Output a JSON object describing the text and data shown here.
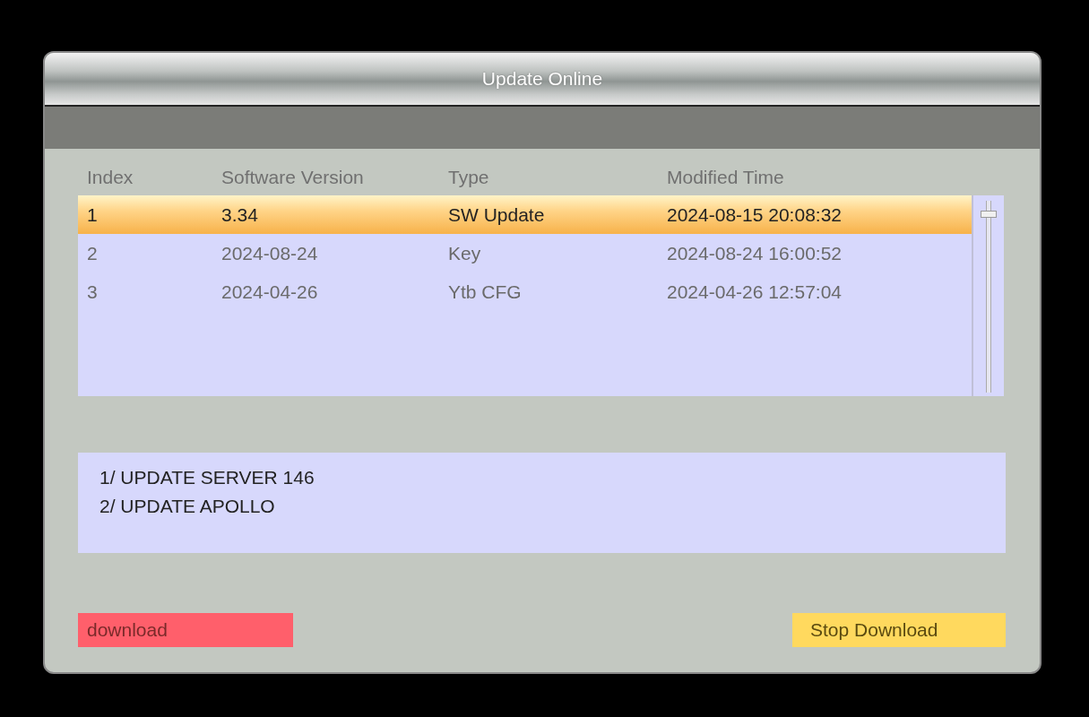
{
  "window": {
    "title": "Update Online"
  },
  "table": {
    "columns": [
      "Index",
      "Software Version",
      "Type",
      "Modified Time"
    ],
    "rows": [
      {
        "cells": [
          "1",
          "3.34",
          "SW Update",
          "2024-08-15 20:08:32"
        ],
        "selected": true
      },
      {
        "cells": [
          "2",
          "2024-08-24",
          "Key",
          "2024-08-24 16:00:52"
        ],
        "selected": false
      },
      {
        "cells": [
          "3",
          "2024-04-26",
          "Ytb CFG",
          "2024-04-26 12:57:04"
        ],
        "selected": false
      }
    ]
  },
  "notes": [
    "1/ UPDATE SERVER 146",
    "2/ UPDATE APOLLO"
  ],
  "buttons": [
    {
      "label": "download",
      "color": "#ff5f6b"
    },
    {
      "label": "Stop Download",
      "color": "#ffd95e"
    }
  ]
}
